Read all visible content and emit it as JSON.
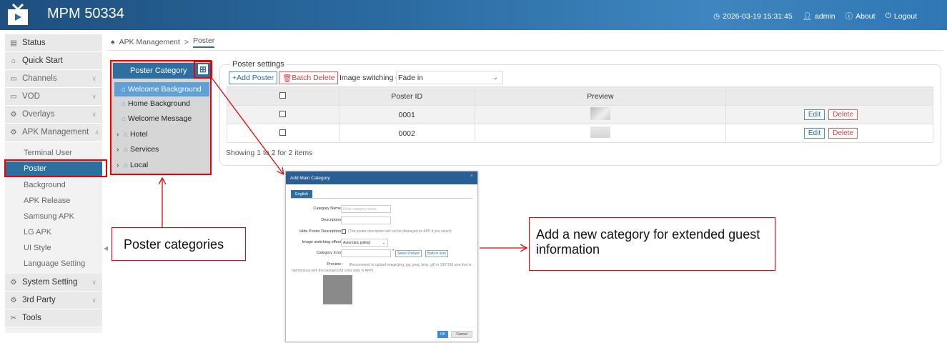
{
  "header": {
    "title": "MPM 50334",
    "datetime": "2026-03-19 15:31:45",
    "user": "admin",
    "about": "About",
    "logout": "Logout"
  },
  "sidebar": {
    "items": [
      {
        "label": "Status",
        "icon": "status-icon"
      },
      {
        "label": "Quick Start",
        "icon": "quickstart-icon"
      },
      {
        "label": "Channels",
        "icon": "channels-icon"
      },
      {
        "label": "VOD",
        "icon": "vod-icon"
      },
      {
        "label": "Overlays",
        "icon": "overlays-icon"
      },
      {
        "label": "APK Management",
        "icon": "apk-icon"
      },
      {
        "label": "System Setting",
        "icon": "system-icon"
      },
      {
        "label": "3rd Party",
        "icon": "thirdparty-icon"
      },
      {
        "label": "Tools",
        "icon": "tools-icon"
      }
    ],
    "sub_items": [
      "Terminal User",
      "Poster",
      "Background",
      "APK Release",
      "Samsung APK",
      "LG APK",
      "UI Style",
      "Language Setting"
    ]
  },
  "breadcrumb": {
    "parent": "APK Management",
    "sep": ">",
    "current": "Poster"
  },
  "category": {
    "title": "Poster Category",
    "items": [
      "Welcome Background",
      "Home Background",
      "Welcome Message",
      "Hotel",
      "Services",
      "Local"
    ]
  },
  "poster": {
    "section_title": "Poster settings",
    "add_label": "+Add Poster",
    "batch_delete_label": "Batch Delete",
    "effect_label": "Image switching effect:",
    "effect_value": "Fade in",
    "columns": [
      "",
      "Poster ID",
      "Preview",
      ""
    ],
    "rows": [
      {
        "id": "0001",
        "edit": "Edit",
        "delete": "Delete"
      },
      {
        "id": "0002",
        "edit": "Edit",
        "delete": "Delete"
      }
    ],
    "showing": "Showing 1 to 2 for 2 items"
  },
  "dialog": {
    "title": "Add Main Category",
    "close": "×",
    "tab": "English",
    "category_name_label": "Category Name :",
    "category_name_placeholder": "Enter category name",
    "description_label": "Description :",
    "hide_label": "Hide Poster Description :",
    "hide_note": "(The poster description will not be displayed on APP if you select)",
    "effect_label": "Image switching effect :",
    "effect_value": "Automatic polling",
    "icon_label": "Category Icon :",
    "select_picture": "Select Picture",
    "built_in_icon": "Built-in icon",
    "preview_label": "Preview :",
    "preview_note": "(Recommend to upload image(png, jpg, jpeg, bmp, gif) in 136*136 size that is harmonious with the background color style in APP)",
    "ok": "OK",
    "cancel": "Cancel"
  },
  "annotations": {
    "poster_categories": "Poster categories",
    "add_category": "Add a new category for extended guest information"
  },
  "colors": {
    "accent": "#2f6f9f",
    "highlight": "#e00000",
    "header": "#2a6aa0"
  }
}
